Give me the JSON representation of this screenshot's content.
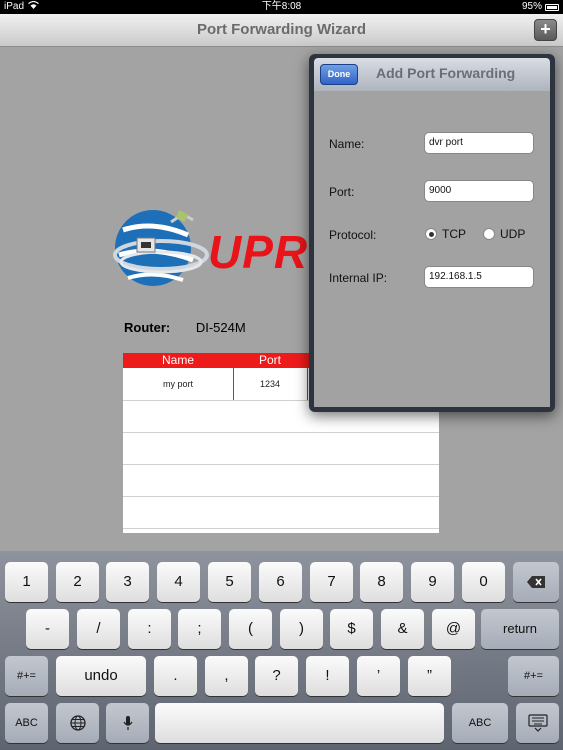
{
  "status": {
    "device": "iPad",
    "time": "下午8:08",
    "battery": "95%"
  },
  "nav": {
    "title": "Port Forwarding Wizard",
    "add_label": "+"
  },
  "logo": {
    "text": "UPRE"
  },
  "router": {
    "label": "Router:",
    "value": "DI-524M"
  },
  "table": {
    "headers": [
      "Name",
      "Port"
    ],
    "rows": [
      {
        "name": "my port",
        "port": "1234"
      }
    ]
  },
  "popover": {
    "done_label": "Done",
    "title": "Add Port Forwarding",
    "fields": {
      "name_label": "Name:",
      "name_value": "dvr port",
      "port_label": "Port:",
      "port_value": "9000",
      "protocol_label": "Protocol:",
      "protocol_options": [
        "TCP",
        "UDP"
      ],
      "protocol_selected": "TCP",
      "ip_label": "Internal IP:",
      "ip_value": "192.168.1.5"
    }
  },
  "keyboard": {
    "row1": [
      "1",
      "2",
      "3",
      "4",
      "5",
      "6",
      "7",
      "8",
      "9",
      "0"
    ],
    "row2": [
      "-",
      "/",
      ":",
      ";",
      "(",
      ")",
      "$",
      "&",
      "@"
    ],
    "return_label": "return",
    "row3_left": "#+=",
    "row3": [
      "undo",
      ".",
      ",",
      "?",
      "!",
      "’",
      "”"
    ],
    "row3_right": "#+=",
    "abc_left": "ABC",
    "abc_right": "ABC",
    "icons": [
      "backspace-icon",
      "globe-icon",
      "microphone-icon",
      "hide-keyboard-icon"
    ]
  },
  "colors": {
    "accent_red": "#ee1b1b",
    "done_blue": "#3a6fd0",
    "popover_frame": "#2d3440"
  }
}
